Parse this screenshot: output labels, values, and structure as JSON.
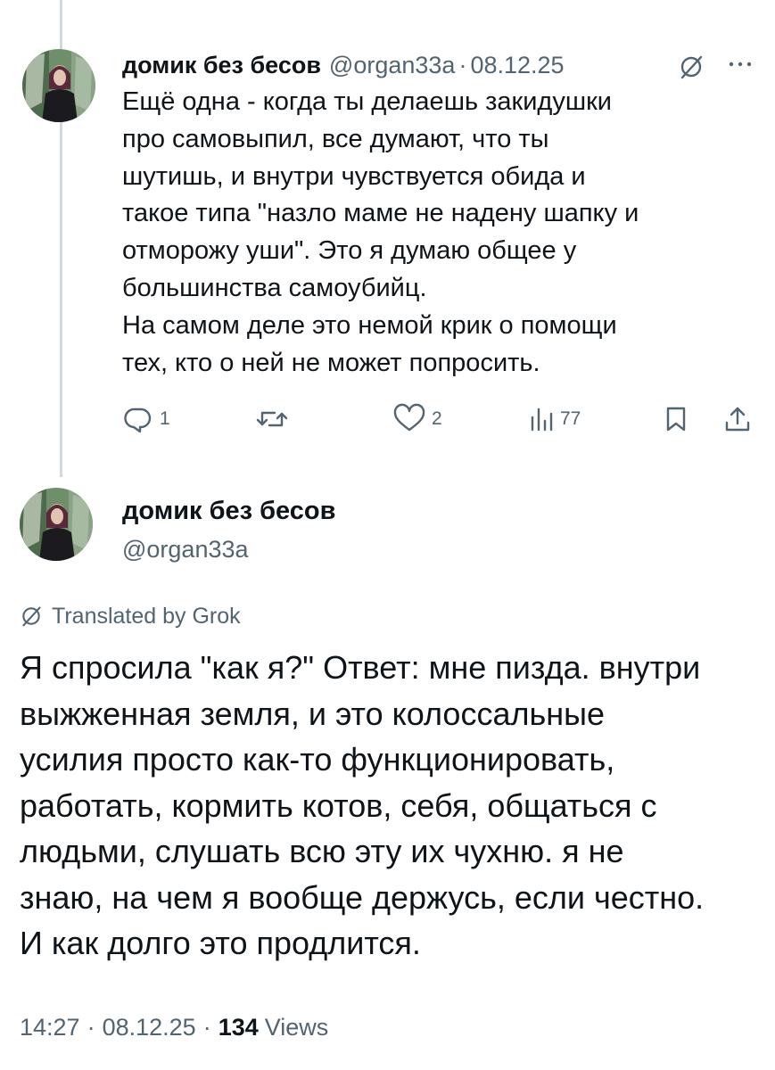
{
  "tweet1": {
    "display_name": "домик без бесов",
    "handle": "@organ33a",
    "separator": "·",
    "date": "08.12.25",
    "body_lines": [
      "Ещё одна - когда ты делаешь закидушки",
      "про самовыпил, все думают, что ты",
      "шутишь, и внутри чувствуется обида и",
      "такое типа \"назло маме не надену шапку и",
      "отморожу уши\". Это я думаю общее у",
      "большинства самоубийц.",
      "На самом деле это немой крик о помощи",
      "тех, кто о ней не может попросить."
    ],
    "actions": {
      "reply_count": "1",
      "repost_count": "",
      "like_count": "2",
      "view_count": "77"
    },
    "icons": [
      "reply-icon",
      "repost-icon",
      "like-icon",
      "views-icon",
      "bookmark-icon",
      "share-icon",
      "grok-icon",
      "more-icon"
    ]
  },
  "tweet2": {
    "display_name": "домик без бесов",
    "handle": "@organ33a",
    "translated_label": "Translated by Grok",
    "body_lines": [
      "Я спросила \"как я?\" Ответ: мне пизда. внутри",
      "выжженная земля, и это колоссальные",
      "усилия просто как-то функционировать,",
      "работать, кормить котов, себя, общаться с",
      "людьми, слушать всю эту их чухню.  я не",
      "знаю, на чем я вообще держусь, если честно.",
      "И как долго это продлится."
    ],
    "footer": {
      "time": "14:27",
      "separator": "·",
      "date": "08.12.25",
      "views_count": "134",
      "views_label": "Views"
    }
  },
  "colors": {
    "text_primary": "#0f1419",
    "text_secondary": "#536471",
    "thread_line": "#cfd9de",
    "background": "#ffffff"
  }
}
